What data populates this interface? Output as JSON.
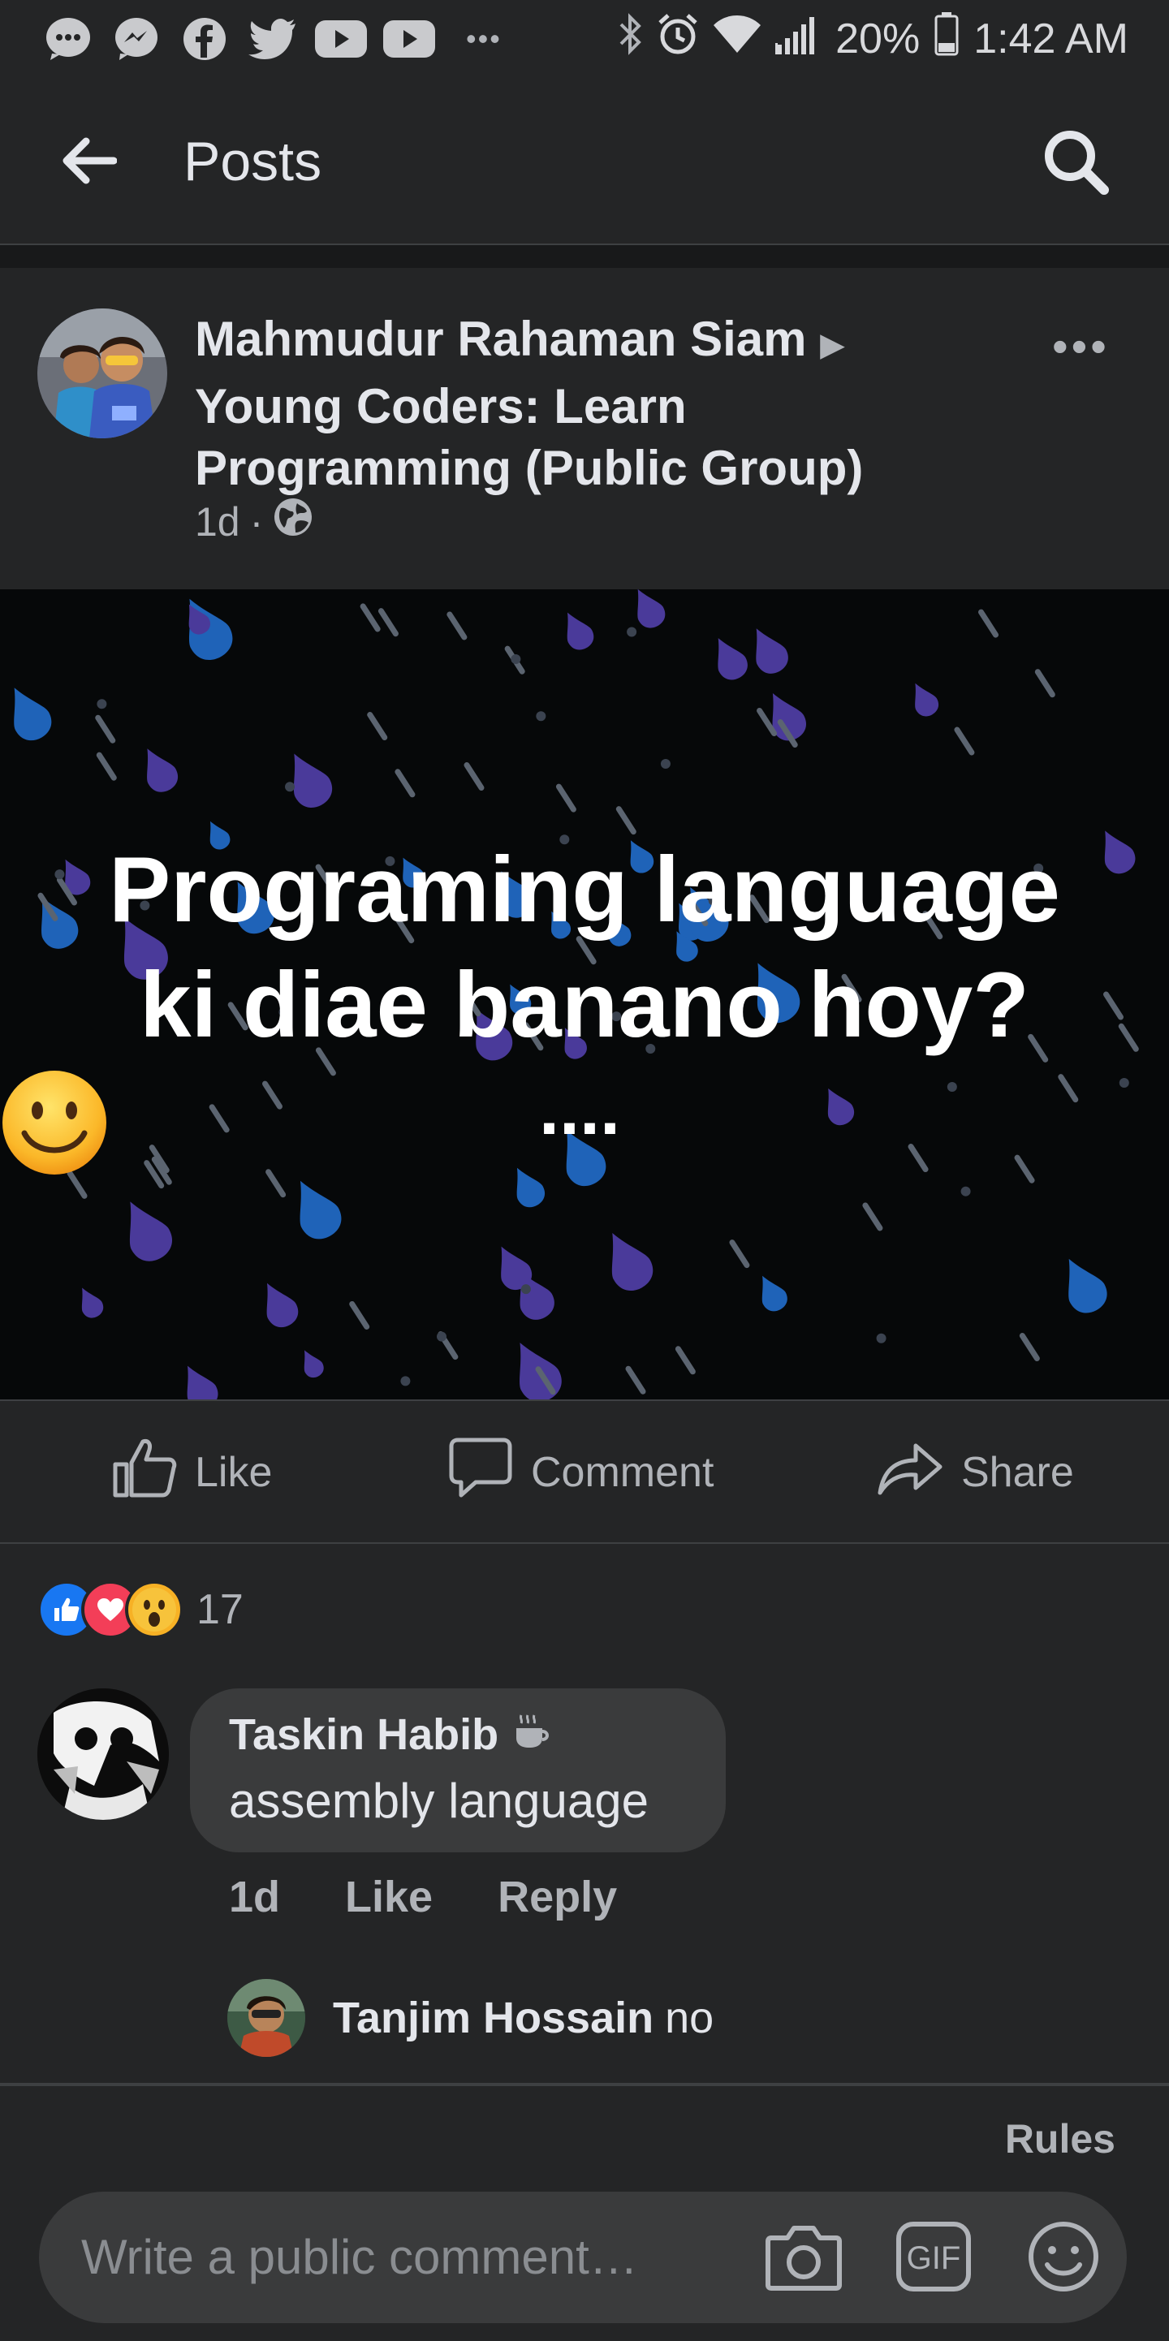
{
  "status_bar": {
    "icons": [
      "messages-icon",
      "messenger-icon",
      "facebook-icon",
      "twitter-icon",
      "youtube-icon",
      "youtube-icon",
      "more-icon"
    ],
    "right_icons": [
      "bluetooth-icon",
      "alarm-icon",
      "wifi-icon",
      "signal-icon"
    ],
    "battery": "20%",
    "time": "1:42 AM"
  },
  "header": {
    "title": "Posts",
    "back_icon": "back-arrow-icon",
    "search_icon": "search-icon"
  },
  "post": {
    "author": "Mahmudur Rahaman Siam",
    "arrow": "▶",
    "group": "Young Coders: Learn Programming (Public Group)",
    "time": "1d",
    "dot": "·",
    "privacy_icon": "globe-icon",
    "more": "•••",
    "text_line1": "Programing language",
    "text_line2": "ki diae banano hoy?",
    "text_dots": "....",
    "emoji": "🙂",
    "background_colors": {
      "base": "#060809",
      "drop_purple": "#4a3a9a",
      "drop_blue": "#1f63b8",
      "streak": "#5b6470"
    }
  },
  "actions": {
    "like": "Like",
    "comment": "Comment",
    "share": "Share"
  },
  "reactions": {
    "types": [
      "like",
      "love",
      "wow"
    ],
    "count": "17",
    "colors": {
      "like": "#1877f2",
      "love": "#f33e58",
      "wow": "#f7b125"
    }
  },
  "comment": {
    "author": "Taskin Habib",
    "badge_icon": "coffee-cup-icon",
    "text": "assembly language",
    "time": "1d",
    "like": "Like",
    "reply": "Reply"
  },
  "reply": {
    "author": "Tanjim Hossain",
    "text": "no"
  },
  "composer": {
    "rules": "Rules",
    "placeholder": "Write a public comment…",
    "icons": [
      "camera-icon",
      "gif-icon",
      "emoji-icon"
    ],
    "gif_label": "GIF"
  }
}
